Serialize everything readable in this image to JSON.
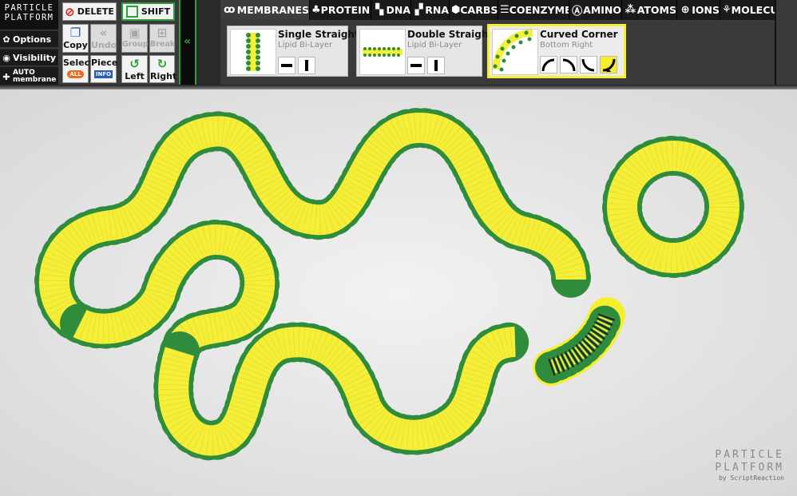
{
  "logo": {
    "line1": "PARTICLE",
    "line2": "PLATFORM"
  },
  "sidebar": {
    "options": "Options",
    "visibility": "Visibility",
    "auto_top": "AUTO",
    "auto_bottom": "membrane"
  },
  "tools": {
    "delete": "DELETE",
    "shift": "SHIFT",
    "copy": "Copy",
    "undo": "Undo",
    "group": "Group",
    "break": "Break",
    "select": "Select",
    "select_badge": "ALL",
    "piece": "Piece",
    "piece_badge": "INFO",
    "left": "Left",
    "right": "Right"
  },
  "tabs": [
    {
      "label": "MEMBRANES",
      "icon": "membrane-icon"
    },
    {
      "label": "PROTEINS",
      "icon": "protein-icon"
    },
    {
      "label": "DNA",
      "icon": "dna-icon"
    },
    {
      "label": "RNA",
      "icon": "rna-icon"
    },
    {
      "label": "CARBS",
      "icon": "carbs-icon"
    },
    {
      "label": "COENZYMES",
      "icon": "coenzyme-icon"
    },
    {
      "label": "AMINO",
      "icon": "amino-icon"
    },
    {
      "label": "ATOMS",
      "icon": "atom-icon"
    },
    {
      "label": "IONS",
      "icon": "ion-icon"
    },
    {
      "label": "MOLECULES",
      "icon": "molecule-icon"
    }
  ],
  "pieces": [
    {
      "title": "Single Straight",
      "subtitle": "Lipid Bi-Layer"
    },
    {
      "title": "Double Straight",
      "subtitle": "Lipid Bi-Layer"
    },
    {
      "title": "Curved Corner",
      "subtitle": "Bottom Right"
    }
  ],
  "watermark": {
    "line1": "PARTICLE",
    "line2": "PLATFORM",
    "line3": "by ScriptReaction"
  },
  "colors": {
    "accent_green": "#2f8c3c",
    "membrane_yellow": "#f6ef3a",
    "selection_yellow": "#f7ef2e"
  }
}
